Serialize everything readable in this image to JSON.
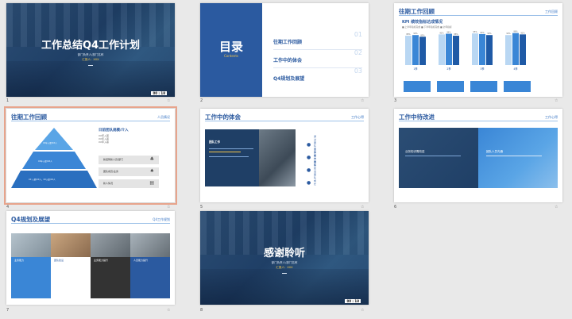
{
  "slides": {
    "s1": {
      "num": "1",
      "title": "工作总结Q4工作计划",
      "sub1": "部门负责人/部门名称",
      "sub2": "汇报人：XXX",
      "foot": "00 : 18"
    },
    "s2": {
      "num": "2",
      "title": "目录",
      "subtitle": "Contents",
      "items": [
        {
          "label": "往期工作回顾",
          "n": "01"
        },
        {
          "label": "工作中的体会",
          "n": "02"
        },
        {
          "label": "Q4规划及展望",
          "n": "03"
        }
      ]
    },
    "s3": {
      "num": "3",
      "title": "往期工作回顾",
      "tag": "工作回顾",
      "chart_caption": "KPI 绩效指标达成情况",
      "legend": "■ 上半年指标完成 ■ 下半年指标完成 ■ 全年指标"
    },
    "s4": {
      "num": "4",
      "title": "往期工作回顾",
      "tag": "人员情况",
      "heading": "日前团队规模/介入",
      "bullets": [
        "XX年入职",
        "XX年入职",
        "XX年入职"
      ],
      "tiers": [
        "XX年入职/XX人",
        "XX年入职/XX人",
        "XX 入职/XX人，XX入职/XX人"
      ],
      "rows": [
        "新招聘新人员/部门",
        "团队成员/业务",
        "新人情况"
      ]
    },
    "s5": {
      "num": "5",
      "title": "工作中的体会",
      "tag": "工作心得",
      "panel_title": "团队工作",
      "items": [
        "通过团队合作提升效率",
        "业务能力",
        "团队建设",
        "团队成长"
      ]
    },
    "s6": {
      "num": "6",
      "title": "工作中待改进",
      "tag": "工作心得",
      "left": "业务知识需改进",
      "right": "团队人员沟通"
    },
    "s7": {
      "num": "7",
      "title": "Q4规划及展望",
      "tag": "Q4工作规划",
      "cols": [
        "业务能力",
        "团队建设",
        "业务能力提升",
        "人员能力提升"
      ]
    },
    "s8": {
      "num": "8",
      "title": "感谢聆听",
      "sub1": "部门负责人/部门名称",
      "sub2": "汇报人：XXX",
      "foot": "00 : 18"
    }
  },
  "chart_data": {
    "type": "bar",
    "title": "KPI 绩效指标达成情况",
    "categories": [
      "1季",
      "2季",
      "3季",
      "4季"
    ],
    "series": [
      {
        "name": "上半年指标完成",
        "values": [
          88,
          92,
          95,
          90
        ]
      },
      {
        "name": "下半年指标完成",
        "values": [
          90,
          94,
          93,
          96
        ]
      },
      {
        "name": "全年指标",
        "values": [
          85,
          88,
          90,
          92
        ]
      }
    ],
    "ylim": [
      0,
      100
    ]
  },
  "colors": {
    "primary": "#2b5aa0",
    "accent": "#3a76c4",
    "dark": "#1f3f66",
    "highlight": "#f3c64b",
    "selection": "#e8a48c"
  }
}
